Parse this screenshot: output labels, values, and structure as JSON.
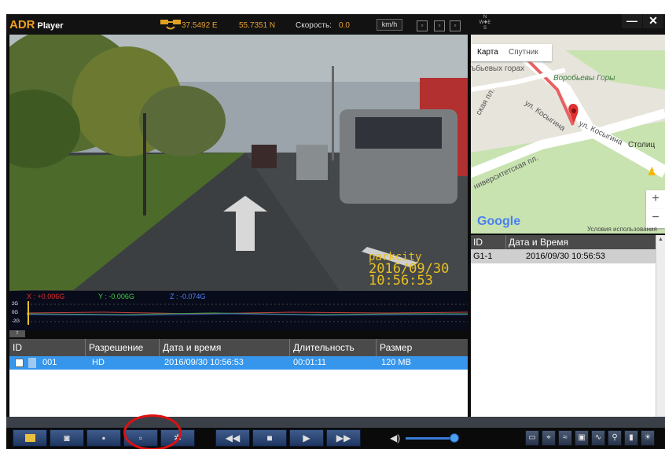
{
  "app": {
    "brand": "ADR",
    "name": "Player"
  },
  "gps": {
    "lon": "37.5492 E",
    "lat": "55.7351 N",
    "speed_label": "Скорость:",
    "speed_value": "0.0",
    "unit": "km/h"
  },
  "window": {
    "minimize": "—",
    "close": "✕"
  },
  "video_overlay": {
    "brand": "parkcity",
    "date": "2016/09/30",
    "time": "10:56:53"
  },
  "sensor": {
    "x": "X : +0.006G",
    "y": "Y : -0.006G",
    "z": "Z : -0.074G",
    "scale": [
      "2G",
      "0G",
      "-2G"
    ]
  },
  "file_list": {
    "columns": [
      "ID",
      "Разрешение",
      "Дата и время",
      "Длительность",
      "Размер"
    ],
    "rows": [
      {
        "id": "001",
        "resolution": "HD",
        "datetime": "2016/09/30 10:56:53",
        "duration": "00:01:11",
        "size": "120 MB"
      }
    ]
  },
  "map": {
    "tabs": [
      "Карта",
      "Спутник"
    ],
    "labels": {
      "place1": "ъбьевых горах",
      "place2": "Воробьевы Горы",
      "street1": "ул. Косыгина",
      "street2": "ул. Косыгина",
      "street3": "ниверситетская пл.",
      "street4": "ская пл.",
      "stolitsa": "Столиц"
    },
    "google": "Google",
    "terms": "Условия использования"
  },
  "gps_list": {
    "columns": [
      "ID",
      "Дата и Время"
    ],
    "rows": [
      {
        "id": "G1-1",
        "datetime": "2016/09/30  10:56:53"
      }
    ]
  },
  "colors": {
    "accent": "#e8a030",
    "selection": "#3596ec",
    "overlay": "#e8c020",
    "annotation": "#e01010"
  },
  "icons": [
    "folder-icon",
    "camera-icon",
    "save-icon",
    "cut-icon",
    "settings-gear-icon",
    "rewind-icon",
    "stop-icon",
    "play-icon",
    "fast-forward-icon",
    "volume-icon",
    "speech-icon",
    "gps-icon",
    "network-icon",
    "image-icon",
    "wave-icon",
    "tool-icon",
    "lock-icon",
    "brightness-icon"
  ]
}
